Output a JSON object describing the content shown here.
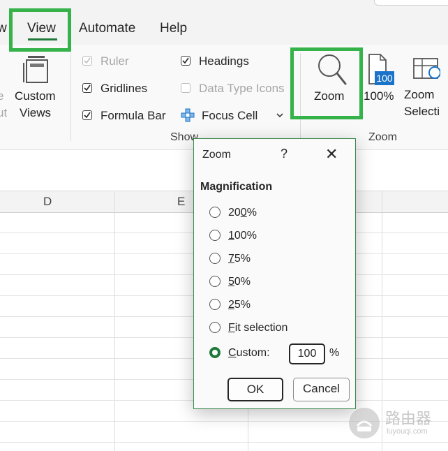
{
  "ribbon": {
    "tabs": [
      {
        "label": "w"
      },
      {
        "label": "View",
        "active": true
      },
      {
        "label": "Automate"
      },
      {
        "label": "Help"
      }
    ],
    "custom_views": {
      "line1": "Custom",
      "line2": "Views",
      "cut1": "e",
      "cut2": "ut"
    },
    "show_group": {
      "label": "Show",
      "items": [
        {
          "label": "Ruler",
          "checked": true,
          "disabled": true
        },
        {
          "label": "Gridlines",
          "checked": true,
          "disabled": false
        },
        {
          "label": "Formula Bar",
          "checked": true,
          "disabled": false
        },
        {
          "label": "Headings",
          "checked": true,
          "disabled": false
        },
        {
          "label": "Data Type Icons",
          "checked": false,
          "disabled": true
        },
        {
          "label": "Focus Cell",
          "icon": "focus-cell-icon"
        }
      ]
    },
    "zoom_group": {
      "label": "Zoom",
      "zoom_button": "Zoom",
      "hundred_button": "100%",
      "hundred_icon_text": "100",
      "zoom_selection_line1": "Zoom",
      "zoom_selection_line2": "Selecti"
    }
  },
  "sheet": {
    "column_headers": [
      "D",
      "E"
    ]
  },
  "zoom_dialog": {
    "title": "Zoom",
    "help": "?",
    "close": "✕",
    "section": "Magnification",
    "options": [
      {
        "mnemonic": "",
        "pre": "20",
        "ul": "0",
        "post": "%",
        "selected": false
      },
      {
        "mnemonic": "1",
        "pre": "",
        "ul": "1",
        "post": "00%",
        "selected": false
      },
      {
        "mnemonic": "7",
        "pre": "",
        "ul": "7",
        "post": "5%",
        "selected": false
      },
      {
        "mnemonic": "5",
        "pre": "",
        "ul": "5",
        "post": "0%",
        "selected": false
      },
      {
        "mnemonic": "2",
        "pre": "",
        "ul": "2",
        "post": "5%",
        "selected": false
      },
      {
        "mnemonic": "F",
        "pre": "",
        "ul": "F",
        "post": "it selection",
        "selected": false
      },
      {
        "mnemonic": "C",
        "pre": "",
        "ul": "C",
        "post": "ustom:",
        "selected": true
      }
    ],
    "custom_value": "100",
    "percent_sign": "%",
    "ok_label": "OK",
    "cancel_label": "Cancel"
  },
  "watermark": {
    "text_cn": "路由器",
    "text_en": "luyouqi.com"
  },
  "colors": {
    "highlight": "#35b34a",
    "accent": "#1f7a3a",
    "zoom_blue": "#1a73c8"
  }
}
